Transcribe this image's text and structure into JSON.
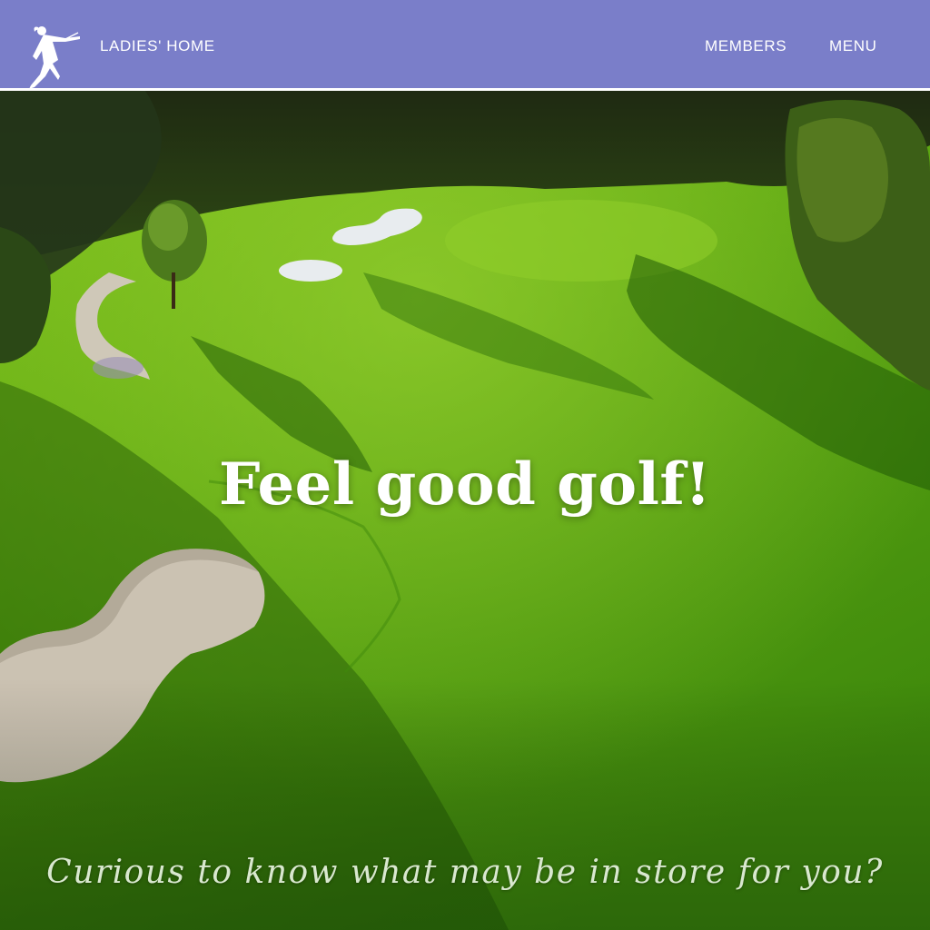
{
  "header": {
    "logo_icon": "female-golfer-logo-icon",
    "home_label": "LADIES' HOME",
    "nav": {
      "members_label": "MEMBERS",
      "menu_label": "MENU"
    },
    "background_color": "#7a7ec9"
  },
  "hero": {
    "image": "golf-course-aerial-photo",
    "headline": "Feel good golf!",
    "tagline": "Curious to know what may be in store for you?"
  }
}
